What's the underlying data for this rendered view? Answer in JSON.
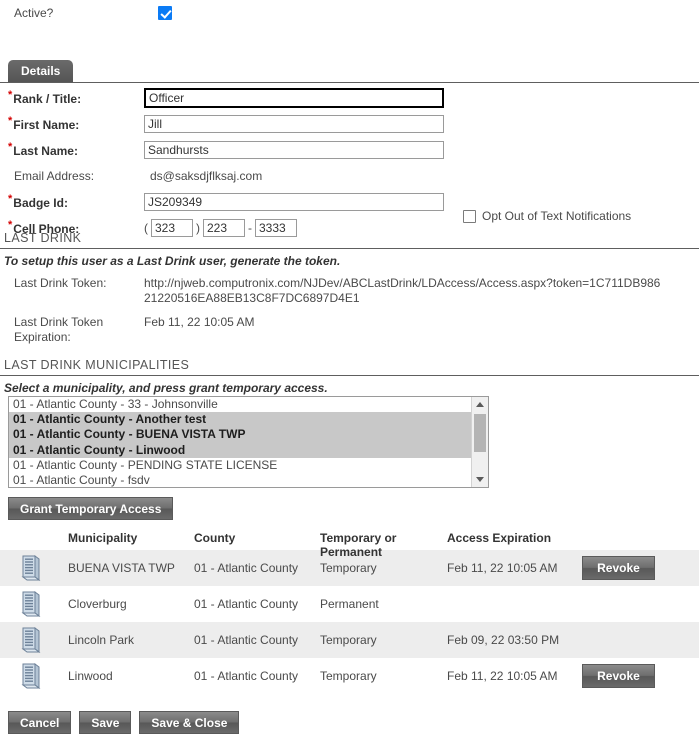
{
  "active": {
    "label": "Active?",
    "checked": true
  },
  "tabs": [
    {
      "label": "Details",
      "active": true
    }
  ],
  "form": {
    "rank_title": {
      "label": "Rank / Title:",
      "value": "Officer",
      "required": true,
      "focused": true
    },
    "first_name": {
      "label": "First Name:",
      "value": "Jill",
      "required": true
    },
    "last_name": {
      "label": "Last Name:",
      "value": "Sandhursts",
      "required": true
    },
    "email_address": {
      "label": "Email Address:",
      "value": "ds@saksdjflksaj.com",
      "required": false
    },
    "badge_id": {
      "label": "Badge Id:",
      "value": "JS209349",
      "required": true
    },
    "cell_phone": {
      "label": "Cell Phone:",
      "required": true,
      "area_code": "323",
      "prefix": "223",
      "line": "3333",
      "open_paren": "(",
      "close_paren": ")",
      "dash": "-"
    },
    "opt_out": {
      "label": "Opt Out of Text Notifications",
      "checked": false
    }
  },
  "last_drink": {
    "section_title": "LAST DRINK",
    "instruction": "To setup this user as a Last Drink user, generate the token.",
    "token_label": "Last Drink Token:",
    "token_value": "http://njweb.computronix.com/NJDev/ABCLastDrink/LDAccess/Access.aspx?token=1C711DB98621220516EA88EB13C8F7DC6897D4E1",
    "expiration_label": "Last Drink Token Expiration:",
    "expiration_value": "Feb 11, 22 10:05 AM"
  },
  "municipalities": {
    "section_title": "LAST DRINK MUNICIPALITIES",
    "instruction": "Select a municipality, and press grant temporary access.",
    "options": [
      {
        "label": "01 - Atlantic County - 33 - Johnsonville",
        "selected": false
      },
      {
        "label": "01 - Atlantic County - Another test",
        "selected": true
      },
      {
        "label": "01 - Atlantic County - BUENA VISTA TWP",
        "selected": true
      },
      {
        "label": "01 - Atlantic County - Linwood",
        "selected": true
      },
      {
        "label": "01 - Atlantic County - PENDING STATE LICENSE",
        "selected": false
      },
      {
        "label": "01 - Atlantic County - fsdv",
        "selected": false
      }
    ],
    "grant_button": "Grant Temporary Access"
  },
  "access_table": {
    "columns": [
      "Municipality",
      "County",
      "Temporary or Permanent",
      "Access Expiration"
    ],
    "rows": [
      {
        "icon": "municipality-building-icon",
        "municipality": "BUENA VISTA TWP",
        "county": "01 - Atlantic County",
        "type": "Temporary",
        "expiration": "Feb 11, 22 10:05 AM",
        "action": "Revoke",
        "has_action": true
      },
      {
        "icon": "municipality-building-icon",
        "municipality": "Cloverburg",
        "county": "01 - Atlantic County",
        "type": "Permanent",
        "expiration": "",
        "action": "",
        "has_action": false
      },
      {
        "icon": "municipality-building-icon",
        "municipality": "Lincoln Park",
        "county": "01 - Atlantic County",
        "type": "Temporary",
        "expiration": "Feb 09, 22 03:50 PM",
        "action": "",
        "has_action": false
      },
      {
        "icon": "municipality-building-icon",
        "municipality": "Linwood",
        "county": "01 - Atlantic County",
        "type": "Temporary",
        "expiration": "Feb 11, 22 10:05 AM",
        "action": "Revoke",
        "has_action": true
      }
    ]
  },
  "footer": {
    "cancel": "Cancel",
    "save": "Save",
    "save_close": "Save & Close"
  },
  "colors": {
    "accent_checkbox": "#0b7bf5",
    "expiration_text": "#e01b1b",
    "button_gray": "#6e6e6e",
    "selection_gray": "#c8c8c8",
    "row_alt": "#ededed"
  }
}
